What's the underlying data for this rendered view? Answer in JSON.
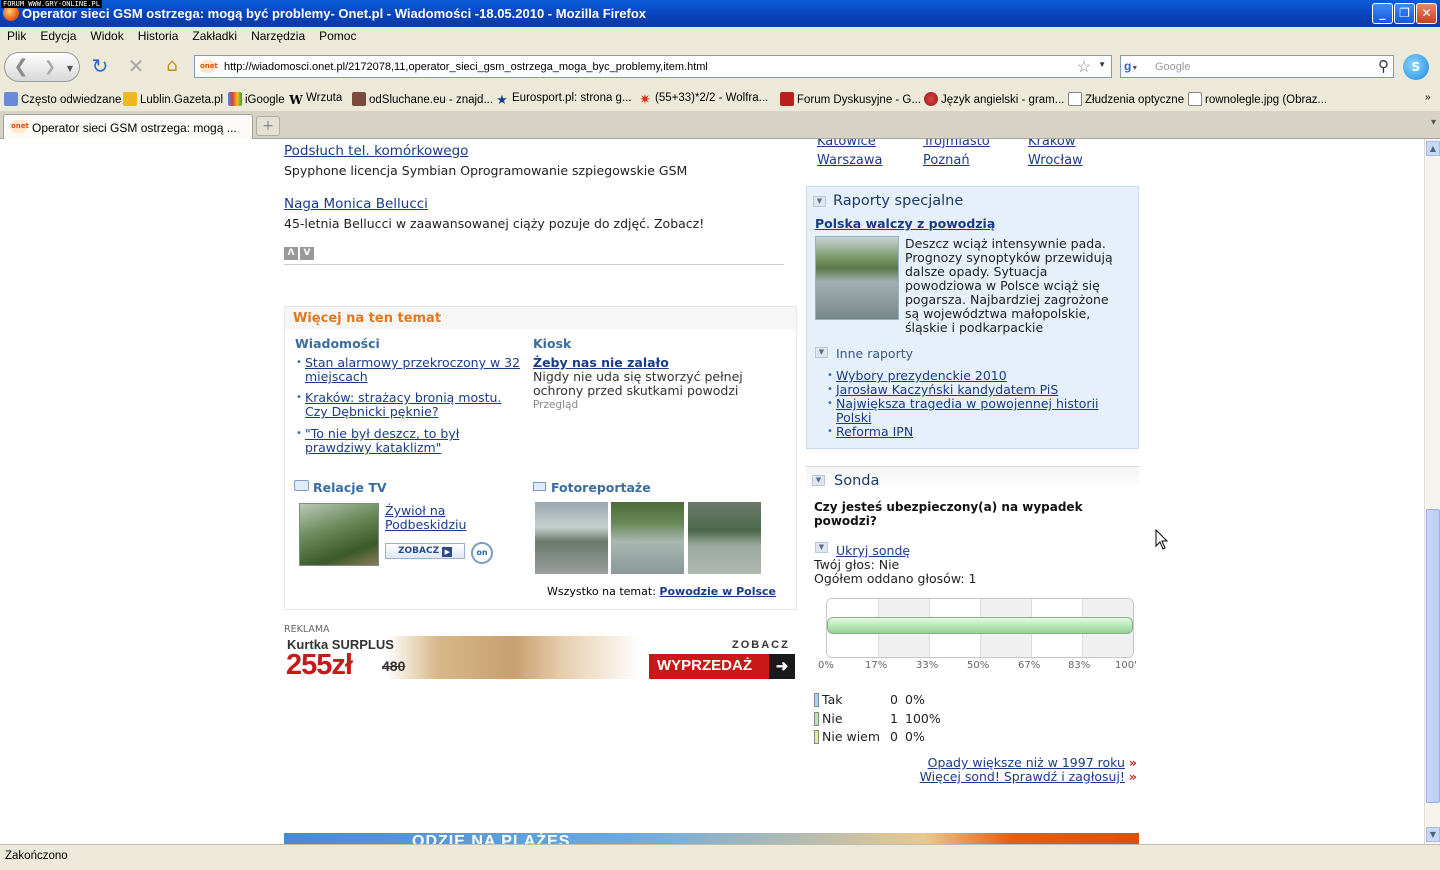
{
  "window": {
    "watermark": "FORUM WWW.GRY-ONLINE.PL",
    "title": "Operator sieci GSM ostrzega: mogą być problemy- Onet.pl - Wiadomości -18.05.2010 - Mozilla Firefox"
  },
  "menu": [
    "Plik",
    "Edycja",
    "Widok",
    "Historia",
    "Zakładki",
    "Narzędzia",
    "Pomoc"
  ],
  "nav": {
    "url": "http://wiadomosci.onet.pl/2172078,11,operator_sieci_gsm_ostrzega_moga_byc_problemy,item.html",
    "url_favicon": "onet",
    "search_placeholder": "Google"
  },
  "bookmarks": [
    "Często odwiedzane",
    "Lublin.Gazeta.pl",
    "iGoogle",
    "Wrzuta",
    "odSluchane.eu - znajd...",
    "Eurosport.pl: strona g...",
    "(55+33)*2/2 - Wolfra...",
    "Forum Dyskusyjne - G...",
    "Język angielski - gram...",
    "Złudzenia optyczne",
    "rownolegle.jpg (Obraz..."
  ],
  "tabs": [
    {
      "label": "Operator sieci GSM ostrzega: mogą ..."
    }
  ],
  "left": {
    "city_links": [
      "Katowice",
      "Trójmiasto",
      "Kraków",
      "Warszawa",
      "Poznań",
      "Wrocław"
    ],
    "articles": [
      {
        "title": "Podsłuch tel. komórkowego",
        "desc": "Spyphone licencja Symbian Oprogramowanie szpiegowskie GSM"
      },
      {
        "title": "Naga Monica Bellucci",
        "desc": "45-letnia Bellucci w zaawansowanej ciąży pozuje do zdjęć. Zobacz!"
      }
    ],
    "more_box": {
      "header": "Więcej na ten temat",
      "wiadomosci_label": "Wiadomości",
      "wiadomosci": [
        [
          "Stan alarmowy przekroczony w 32",
          "miejscach"
        ],
        [
          "Kraków: strażacy bronią mostu.",
          "Czy Dębnicki pęknie?"
        ],
        [
          "\"To nie był deszcz, to był",
          "prawdziwy kataklizm\""
        ]
      ],
      "kiosk_label": "Kiosk",
      "kiosk_title": "Żeby nas nie zalało",
      "kiosk_desc": [
        "Nigdy nie uda się stworzyć pełnej",
        "ochrony przed skutkami powodzi"
      ],
      "kiosk_source": "Przegląd",
      "tv_label": "Relacje TV",
      "tv_link": [
        "Żywioł na",
        "Podbeskidziu"
      ],
      "tv_button": "ZOBACZ",
      "tv_logo": "on",
      "foto_label": "Fotoreportaże",
      "all_prefix": "Wszystko na temat:",
      "all_link": "Powodzie w Polsce"
    },
    "ad_label": "REKLAMA",
    "ad": {
      "brand": "Kurtka SURPLUS",
      "price": "255zł",
      "old_price": "480",
      "cta_top": "ZOBACZ",
      "cta": "WYPRZEDAŻ"
    },
    "bottom_banner": "ODZIE NA PLAŻĘS"
  },
  "raporty": {
    "header": "Raporty specjalne",
    "main_link": "Polska walczy z powodzią",
    "main_desc": [
      "Deszcz wciąż intensywnie pada.",
      "Prognozy synoptyków przewidują",
      "dalsze opady. Sytuacja",
      "powodziowa w Polsce wciąż się",
      "pogarsza. Najbardziej zagrożone",
      "są województwa małopolskie,",
      "śląskie i podkarpackie"
    ],
    "inne_label": "Inne raporty",
    "inne": [
      [
        "Wybory prezydenckie 2010"
      ],
      [
        "Jarosław Kaczyński kandydatem PiS"
      ],
      [
        "Największa tragedia w powojennej historii",
        "Polski"
      ],
      [
        "Reforma IPN"
      ]
    ]
  },
  "sonda": {
    "header": "Sonda",
    "question": [
      "Czy jesteś ubezpieczony(a) na wypadek",
      "powodzi?"
    ],
    "hide_link": "Ukryj sondę",
    "your_vote": "Twój głos: Nie",
    "total": "Ogółem oddano głosów: 1",
    "axis": [
      "0%",
      "17%",
      "33%",
      "50%",
      "67%",
      "83%",
      "100'"
    ],
    "results": [
      {
        "label": "Tak",
        "count": "0",
        "pct": "0%",
        "fraction": 0,
        "color": "#9fd8ef"
      },
      {
        "label": "Nie",
        "count": "1",
        "pct": "100%",
        "fraction": 1,
        "color": "#b9e6b0"
      },
      {
        "label": "Nie wiem",
        "count": "0",
        "pct": "0%",
        "fraction": 0,
        "color": "#e6eb9a"
      }
    ],
    "links": [
      "Opady większe niż w 1997 roku",
      "Więcej sond! Sprawdź i zagłosuj!"
    ],
    "link_arrow": "»"
  },
  "status": "Zakończono",
  "colors": {
    "link": "#1a3b8a",
    "accent_orange": "#e07820",
    "section_blue": "#3a6da0"
  }
}
